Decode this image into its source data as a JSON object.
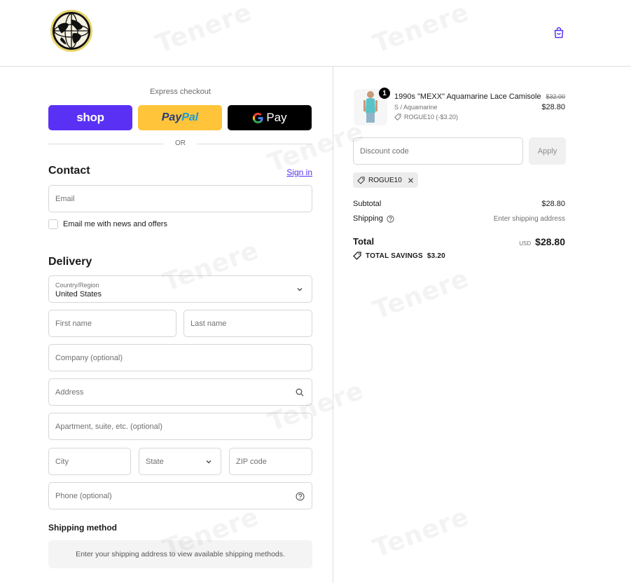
{
  "header": {
    "cart_icon": "shopping-bag-icon",
    "accent": "#5a31f4"
  },
  "express": {
    "title": "Express checkout",
    "shop_label": "shop",
    "paypal_label_a": "Pay",
    "paypal_label_b": "Pal",
    "gpay_label": "Pay",
    "or_label": "OR"
  },
  "contact": {
    "title": "Contact",
    "sign_in": "Sign in",
    "email_placeholder": "Email",
    "newsletter_label": "Email me with news and offers"
  },
  "delivery": {
    "title": "Delivery",
    "country_label": "Country/Region",
    "country_value": "United States",
    "first_name": "First name",
    "last_name": "Last name",
    "company": "Company (optional)",
    "address": "Address",
    "apartment": "Apartment, suite, etc. (optional)",
    "city": "City",
    "state": "State",
    "zip": "ZIP code",
    "phone": "Phone (optional)"
  },
  "shipping_method": {
    "title": "Shipping method",
    "message": "Enter your shipping address to view available shipping methods."
  },
  "order": {
    "quantity": "1",
    "product_name": "1990s \"MEXX\" Aquamarine Lace Camisole",
    "variant": "S / Aquamarine",
    "discount_line": "ROGUE10 (-$3.20)",
    "old_price": "$32.00",
    "price": "$28.80",
    "discount_placeholder": "Discount code",
    "apply_label": "Apply",
    "applied_code": "ROGUE10",
    "subtotal_label": "Subtotal",
    "subtotal_value": "$28.80",
    "shipping_label": "Shipping",
    "shipping_value": "Enter shipping address",
    "total_label": "Total",
    "currency": "USD",
    "total_value": "$28.80",
    "savings_label": "TOTAL SAVINGS",
    "savings_value": "$3.20"
  }
}
